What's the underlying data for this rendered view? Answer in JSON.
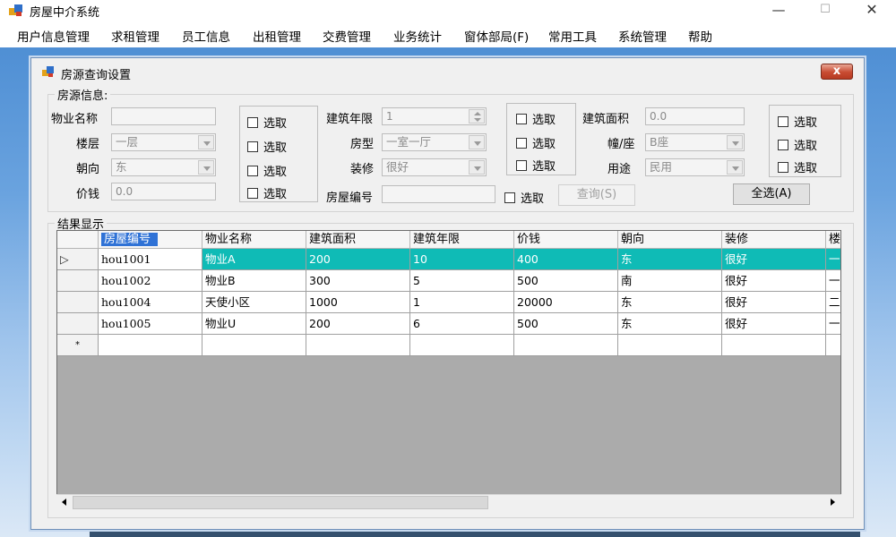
{
  "window": {
    "title": "房屋中介系统",
    "minimize": "—",
    "maximize": "☐",
    "close": "✕"
  },
  "menu": [
    "用户信息管理",
    "求租管理",
    "员工信息",
    "出租管理",
    "交费管理",
    "业务统计",
    "窗体部局(F)",
    "常用工具",
    "系统管理",
    "帮助"
  ],
  "dialog": {
    "title": "房源查询设置",
    "close": "x",
    "source_group": "房源信息:",
    "fields": {
      "name_label": "物业名称",
      "name_value": "",
      "floor_label": "楼层",
      "floor_value": "一层",
      "orient_label": "朝向",
      "orient_value": "东",
      "price_label": "价钱",
      "price_value": "0.0",
      "age_label": "建筑年限",
      "age_value": "1",
      "type_label": "房型",
      "type_value": "一室一厅",
      "decor_label": "装修",
      "decor_value": "很好",
      "code_label": "房屋编号",
      "code_value": "",
      "area_label": "建筑面积",
      "area_value": "0.0",
      "building_label": "幢/座",
      "building_value": "B座",
      "use_label": "用途",
      "use_value": "民用"
    },
    "checkbox_label": "选取",
    "query_button": "查询(S)",
    "select_all_button": "全选(A)",
    "result_group": "结果显示"
  },
  "grid": {
    "columns": [
      "房屋编号",
      "物业名称",
      "建筑面积",
      "建筑年限",
      "价钱",
      "朝向",
      "装修",
      "楼层"
    ],
    "rows": [
      [
        "hou1001",
        "物业A",
        "200",
        "10",
        "400",
        "东",
        "很好",
        "一层"
      ],
      [
        "hou1002",
        "物业B",
        "300",
        "5",
        "500",
        "南",
        "很好",
        "一层"
      ],
      [
        "hou1004",
        "天使小区",
        "1000",
        "1",
        "20000",
        "东",
        "很好",
        "二层"
      ],
      [
        "hou1005",
        "物业U",
        "200",
        "6",
        "500",
        "东",
        "很好",
        "一层"
      ]
    ],
    "current_marker": "▷",
    "new_row_marker": "*"
  }
}
